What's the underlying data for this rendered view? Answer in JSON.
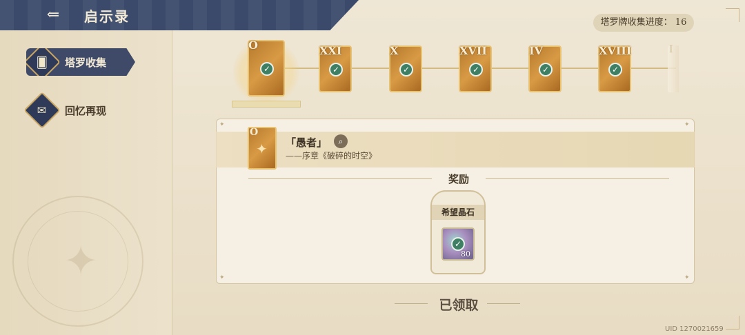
{
  "header": {
    "title": "启示录",
    "back_icon": "back-arrow-icon"
  },
  "sidebar": {
    "items": [
      {
        "label": "塔罗收集",
        "icon": "tarot-cards-icon",
        "active": true
      },
      {
        "label": "回忆再现",
        "icon": "memory-card-icon",
        "active": false
      }
    ]
  },
  "progress": {
    "label": "塔罗牌收集进度：",
    "count": "16"
  },
  "cards": [
    {
      "numeral": "O",
      "collected": true,
      "selected": true
    },
    {
      "numeral": "XXI",
      "collected": true,
      "selected": false
    },
    {
      "numeral": "X",
      "collected": true,
      "selected": false
    },
    {
      "numeral": "XVII",
      "collected": true,
      "selected": false
    },
    {
      "numeral": "IV",
      "collected": true,
      "selected": false
    },
    {
      "numeral": "XVIII",
      "collected": true,
      "selected": false
    },
    {
      "numeral": "I",
      "collected": false,
      "selected": false
    }
  ],
  "detail": {
    "numeral": "O",
    "name": "「愚者」",
    "subtitle": "——序章《破碎的时空》",
    "reward_heading": "奖励",
    "reward": {
      "name": "希望晶石",
      "quantity": "80",
      "claimed": true
    },
    "status": "已领取"
  },
  "uid": "UID 1270021659",
  "colors": {
    "header_bg": "#3b4a6b",
    "card_gold": "#d89a44",
    "check_green": "#3f7f63",
    "background": "#e9e0cc"
  }
}
